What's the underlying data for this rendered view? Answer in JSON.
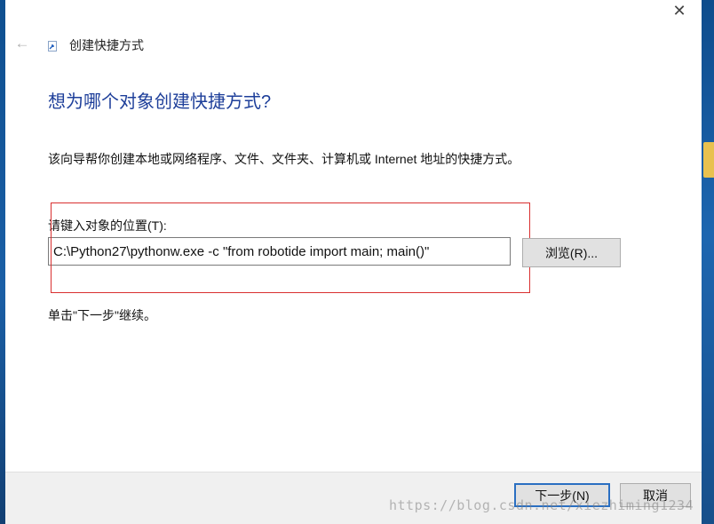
{
  "window": {
    "title": "创建快捷方式",
    "close_glyph": "✕",
    "back_glyph": "←"
  },
  "page": {
    "heading": "想为哪个对象创建快捷方式?",
    "description": "该向导帮你创建本地或网络程序、文件、文件夹、计算机或 Internet 地址的快捷方式。",
    "location_label": "请键入对象的位置(T):",
    "location_value": "C:\\Python27\\pythonw.exe -c \"from robotide import main; main()\"",
    "browse_label": "浏览(R)...",
    "hint": "单击\"下一步\"继续。"
  },
  "buttons": {
    "next_label": "下一步(N)",
    "cancel_label": "取消"
  },
  "watermark": "https://blog.csdn.net/xiezhiming1234",
  "colors": {
    "heading": "#1e3f9a",
    "annotation_box": "#d93030",
    "default_button_border": "#2a6fc2"
  }
}
